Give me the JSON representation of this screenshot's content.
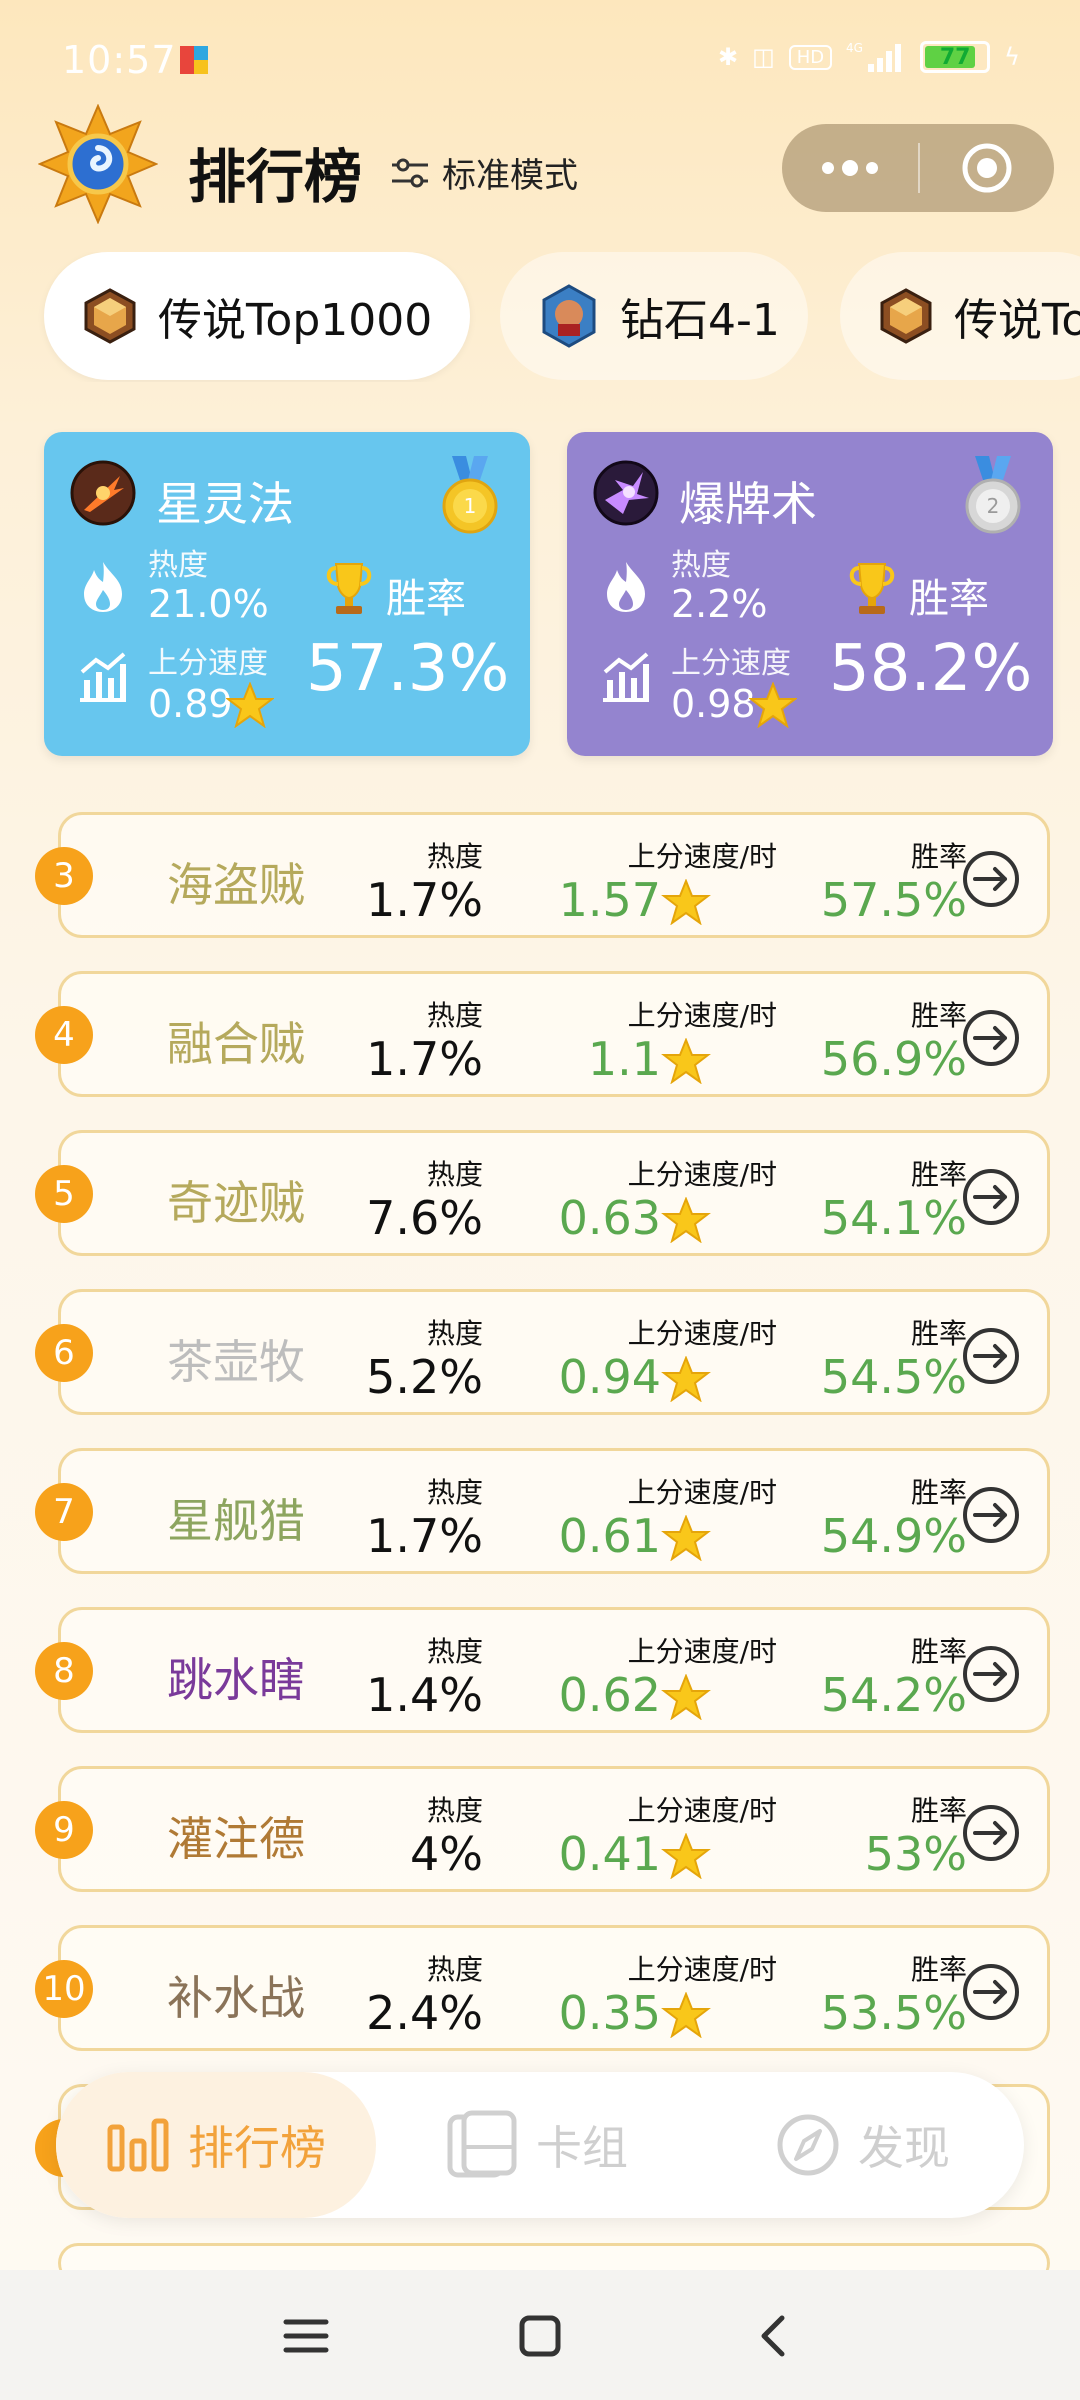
{
  "status_bar": {
    "time": "10:57",
    "battery": "77"
  },
  "header": {
    "title": "排行榜",
    "mode_label": "标准模式"
  },
  "rank_tabs": [
    {
      "label": "传说Top1000",
      "active": true
    },
    {
      "label": "钻石4-1",
      "active": false
    },
    {
      "label": "传说Top",
      "active": false
    }
  ],
  "top_cards": [
    {
      "name": "星灵法",
      "rank": "1",
      "popularity_label": "热度",
      "popularity": "21.0%",
      "speed_label": "上分速度",
      "speed": "0.89",
      "winrate_label": "胜率",
      "winrate": "57.3%",
      "color": "#67c6ee"
    },
    {
      "name": "爆牌术",
      "rank": "2",
      "popularity_label": "热度",
      "popularity": "2.2%",
      "speed_label": "上分速度",
      "speed": "0.98",
      "winrate_label": "胜率",
      "winrate": "58.2%",
      "color": "#9484cf"
    }
  ],
  "list_labels": {
    "popularity": "热度",
    "speed": "上分速度/时",
    "winrate": "胜率"
  },
  "decks": [
    {
      "rank": "3",
      "name": "海盗贼",
      "popularity": "1.7%",
      "speed": "1.57",
      "winrate": "57.5%",
      "name_color": "#b5a95c"
    },
    {
      "rank": "4",
      "name": "融合贼",
      "popularity": "1.7%",
      "speed": "1.1",
      "winrate": "56.9%",
      "name_color": "#b5a95c"
    },
    {
      "rank": "5",
      "name": "奇迹贼",
      "popularity": "7.6%",
      "speed": "0.63",
      "winrate": "54.1%",
      "name_color": "#b5a95c"
    },
    {
      "rank": "6",
      "name": "茶壶牧",
      "popularity": "5.2%",
      "speed": "0.94",
      "winrate": "54.5%",
      "name_color": "#bdbdbd"
    },
    {
      "rank": "7",
      "name": "星舰猎",
      "popularity": "1.7%",
      "speed": "0.61",
      "winrate": "54.9%",
      "name_color": "#8da55f"
    },
    {
      "rank": "8",
      "name": "跳水瞎",
      "popularity": "1.4%",
      "speed": "0.62",
      "winrate": "54.2%",
      "name_color": "#7a3a9a"
    },
    {
      "rank": "9",
      "name": "灌注德",
      "popularity": "4%",
      "speed": "0.41",
      "winrate": "53%",
      "name_color": "#b07a35"
    },
    {
      "rank": "10",
      "name": "补水战",
      "popularity": "2.4%",
      "speed": "0.35",
      "winrate": "53.5%",
      "name_color": "#8a7358"
    }
  ],
  "bottom_nav": {
    "ranking": "排行榜",
    "decks": "卡组",
    "discover": "发现"
  }
}
